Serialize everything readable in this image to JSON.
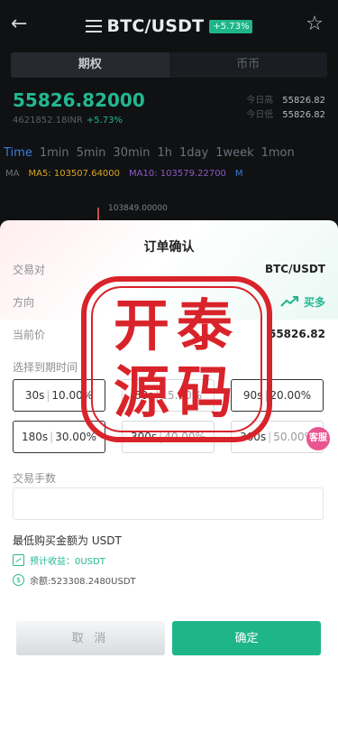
{
  "header": {
    "back_icon": "arrow-left-icon",
    "menu_icon": "list-icon",
    "pair": "BTC/USDT",
    "change": "+5.73%",
    "star_icon": "star-outline-icon"
  },
  "mode_tabs": [
    {
      "label": "期权",
      "active": true
    },
    {
      "label": "币币",
      "active": false
    }
  ],
  "ticker": {
    "price": "55826.82000",
    "sub_value": "4621852.18INR",
    "sub_change": "+5.73%",
    "high_label": "今日高",
    "high_value": "55826.82",
    "low_label": "今日低",
    "low_value": "55826.82"
  },
  "timeframes": [
    {
      "label": "Time",
      "active": true
    },
    {
      "label": "1min"
    },
    {
      "label": "5min"
    },
    {
      "label": "30min"
    },
    {
      "label": "1h"
    },
    {
      "label": "1day"
    },
    {
      "label": "1week"
    },
    {
      "label": "1mon"
    }
  ],
  "indicators": {
    "ma": "MA",
    "ma5": "MA5: 103507.64000",
    "ma10": "MA10: 103579.22700",
    "m": "M"
  },
  "chart_peak": "103849.00000",
  "modal": {
    "title": "订单确认",
    "pair_label": "交易对",
    "pair_value": "BTC/USDT",
    "direction_label": "方向",
    "direction_value": "买多",
    "price_label": "当前价",
    "price_value": "55826.82",
    "expiry_label": "选择到期时间",
    "options": [
      {
        "sec": "30s",
        "rate": "10.00%",
        "selected": true
      },
      {
        "sec": "60s",
        "rate": "15.00%",
        "selected": false
      },
      {
        "sec": "90s",
        "rate": "20.00%",
        "selected": true
      },
      {
        "sec": "180s",
        "rate": "30.00%",
        "selected": true
      },
      {
        "sec": "300s",
        "rate": "40.00%",
        "selected": false
      },
      {
        "sec": "360s",
        "rate": "50.00%",
        "selected": false
      }
    ],
    "qty_label": "交易手数",
    "qty_value": "",
    "min_buy": "最低购买金额为 USDT",
    "est_profit": "预计收益：0USDT",
    "balance": "余额:523308.2480USDT",
    "cancel": "取 消",
    "confirm": "确定"
  },
  "stamp": {
    "line1": "开泰",
    "line2": "源码",
    "color": "#d9232a"
  },
  "float_button": "客服",
  "colors": {
    "up": "#1fb58a",
    "accent": "#3a7bd5",
    "stamp": "#d9232a"
  }
}
